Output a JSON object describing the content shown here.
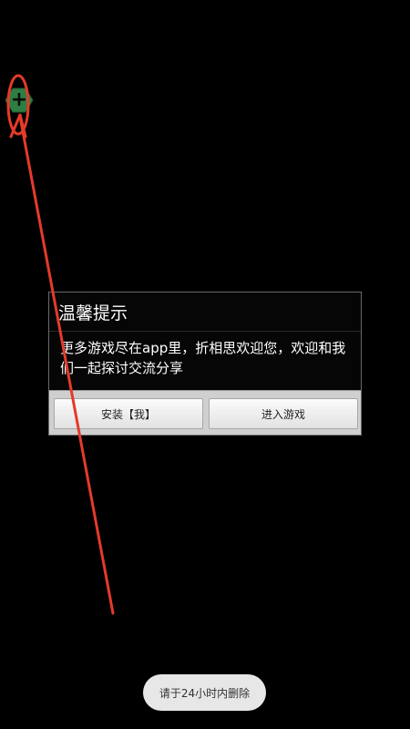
{
  "floating_widget": {
    "icon": "plus-icon",
    "color": "#2e7d43"
  },
  "dialog": {
    "title": "温馨提示",
    "message": "更多游戏尽在app里，折相思欢迎您，欢迎和我们一起探讨交流分享",
    "buttons": {
      "install": "安装【我】",
      "enter_game": "进入游戏"
    }
  },
  "toast": {
    "text": "请于24小时内删除"
  },
  "annotation": {
    "color": "#e53a2a"
  }
}
